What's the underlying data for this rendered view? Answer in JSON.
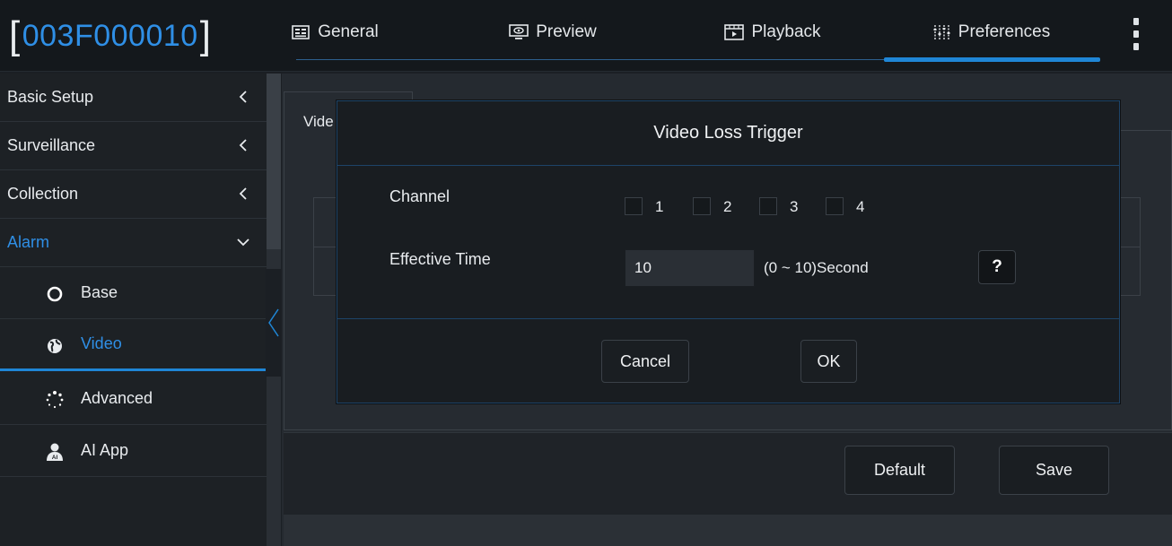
{
  "header": {
    "device_id": "003F000010",
    "tabs": [
      {
        "label": "General",
        "icon": "general-icon"
      },
      {
        "label": "Preview",
        "icon": "preview-icon"
      },
      {
        "label": "Playback",
        "icon": "playback-icon"
      },
      {
        "label": "Preferences",
        "icon": "preferences-icon",
        "active": true
      }
    ]
  },
  "sidebar": {
    "items": [
      {
        "label": "Basic Setup"
      },
      {
        "label": "Surveillance"
      },
      {
        "label": "Collection"
      },
      {
        "label": "Alarm",
        "expanded": true
      }
    ],
    "sub_items": [
      {
        "label": "Base",
        "icon": "circle-icon"
      },
      {
        "label": "Video",
        "icon": "globe-icon",
        "active": true
      },
      {
        "label": "Advanced",
        "icon": "dots-icon"
      },
      {
        "label": "AI App",
        "icon": "ai-user-icon"
      }
    ]
  },
  "page": {
    "tab_label": "Vide",
    "default_label": "Default",
    "save_label": "Save"
  },
  "modal": {
    "title": "Video Loss Trigger",
    "channel_label": "Channel",
    "channels": [
      "1",
      "2",
      "3",
      "4"
    ],
    "effective_time_label": "Effective Time",
    "effective_time_value": "10",
    "range_text": "(0 ~ 10)Second",
    "help_label": "?",
    "cancel_label": "Cancel",
    "ok_label": "OK"
  },
  "colors": {
    "accent": "#1f86d6",
    "device_id": "#2f8fe6",
    "background": "#1b1f24"
  }
}
